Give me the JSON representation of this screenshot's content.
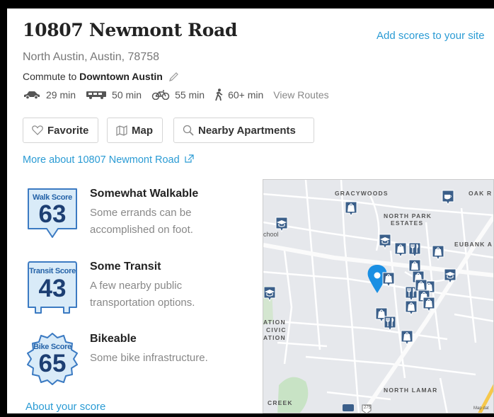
{
  "header": {
    "title": "10807 Newmont Road",
    "add_scores": "Add scores to your site",
    "address": "North Austin, Austin, 78758",
    "commute_prefix": "Commute to",
    "commute_dest": "Downtown Austin"
  },
  "routes": {
    "car": "29 min",
    "bus": "50 min",
    "bike": "55 min",
    "walk": "60+ min",
    "view_routes": "View Routes"
  },
  "buttons": {
    "favorite": "Favorite",
    "map": "Map",
    "nearby": "Nearby Apartments"
  },
  "more_link": "More about 10807 Newmont Road",
  "scores": {
    "walk": {
      "label": "Walk Score",
      "value": "63",
      "title": "Somewhat Walkable",
      "desc": "Some errands can be accomplished on foot."
    },
    "transit": {
      "label": "Transit Score",
      "value": "43",
      "title": "Some Transit",
      "desc": "A few nearby public transportation options."
    },
    "bike": {
      "label": "Bike Score",
      "value": "65",
      "title": "Bikeable",
      "desc": "Some bike infrastructure."
    }
  },
  "about_score": "About your score",
  "map": {
    "labels": [
      "GRACYWOODS",
      "OAK R",
      "NORTH PARK",
      "ESTATES",
      "EUBANK A",
      "ATION",
      "CIVIC",
      "ATION",
      "NORTH LAMAR",
      "CREEK",
      "chool",
      "Map dat"
    ],
    "road_shield": "275"
  },
  "colors": {
    "accent": "#2a9bd4",
    "badge_fill": "#d9ebf8",
    "badge_stroke": "#3b7ac2",
    "badge_num": "#1d3f73",
    "pin": "#1a8fe3",
    "poi": "#3b5f8a"
  }
}
